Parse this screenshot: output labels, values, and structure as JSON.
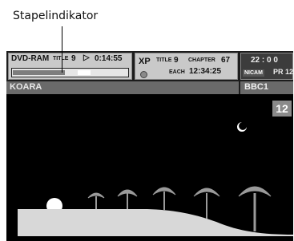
{
  "callout": {
    "label": "Stapelindikator"
  },
  "osd": {
    "left": {
      "format": "DVD-RAM",
      "title_label": "TITLE",
      "title_number": "9",
      "play_symbol": "▷",
      "elapsed_time": "0:14:55",
      "progress": 0.45
    },
    "middle": {
      "mode": "XP",
      "title_label": "TITLE",
      "title_number": "9",
      "chapter_label": "CHAPTER",
      "chapter_number": "67",
      "each_label": "EACH",
      "time": "12:34:25",
      "disc_icon": "disc-icon"
    },
    "right": {
      "clock": "22 : 0 0",
      "audio_badge": "NICAM",
      "program": "PR 12"
    },
    "subtitle": "KOARA",
    "channel_name": "BBC1",
    "channel_number": "12"
  },
  "colors": {
    "osd_bg": "#c9c9c9",
    "screen_bg": "#000000",
    "scene_ground": "#d8d8d8"
  }
}
